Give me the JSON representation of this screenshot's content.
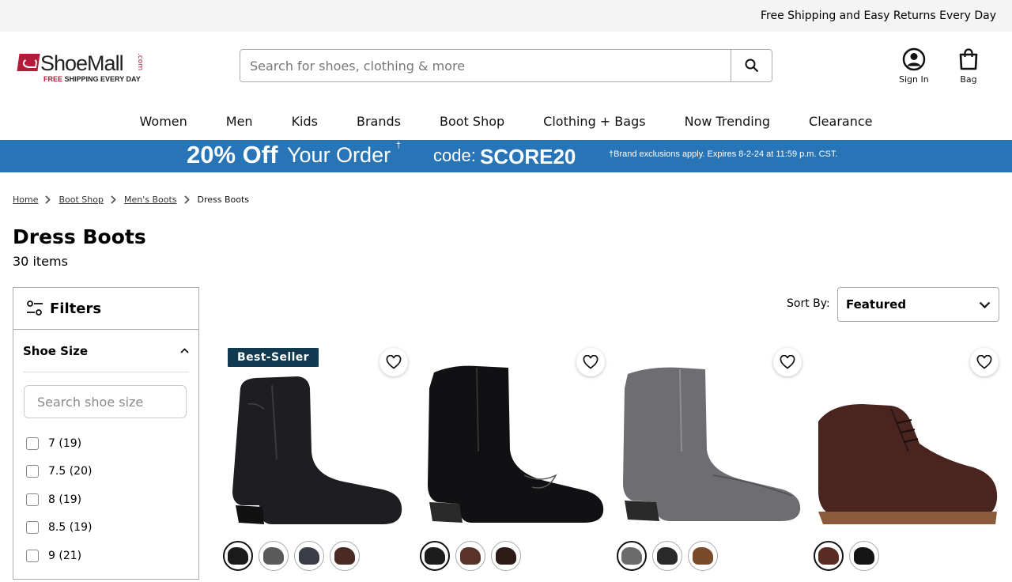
{
  "topbar": {
    "message": "Free Shipping and Easy Returns Every Day"
  },
  "logo": {
    "text": "ShoeMall",
    "dotcom": ".com",
    "tag_red": "FREE",
    "tag_rest": " SHIPPING EVERY DAY"
  },
  "search": {
    "placeholder": "Search for shoes, clothing & more"
  },
  "account": {
    "sign_in": "Sign In",
    "bag": "Bag"
  },
  "nav": {
    "women": "Women",
    "men": "Men",
    "kids": "Kids",
    "brands": "Brands",
    "boot_shop": "Boot Shop",
    "clothing": "Clothing + Bags",
    "trending": "Now Trending",
    "clearance": "Clearance"
  },
  "promo": {
    "headline_bold": "20% Off",
    "headline_rest": "Your Order",
    "dagger": "†",
    "code_label": "code:",
    "code": "SCORE20",
    "disclaimer": "†Brand exclusions apply. Expires 8-2-24 at 11:59 p.m. CST."
  },
  "breadcrumb": {
    "home": "Home",
    "boot_shop": "Boot Shop",
    "mens_boots": "Men's Boots",
    "current": "Dress Boots"
  },
  "page": {
    "title": "Dress Boots",
    "count": "30 items"
  },
  "filters": {
    "title": "Filters",
    "shoe_size": {
      "label": "Shoe Size",
      "placeholder": "Search shoe size"
    },
    "sizes": [
      "7 (19)",
      "7.5 (20)",
      "8 (19)",
      "8.5 (19)",
      "9 (21)"
    ]
  },
  "sort": {
    "label": "Sort By:",
    "selected": "Featured"
  },
  "products": [
    {
      "badge": "Best-Seller",
      "image": "black-side-zip-dress-boot",
      "swatch_colors": [
        "#1a1a1a",
        "#5a5a5a",
        "#3b3d46",
        "#4a2a22"
      ]
    },
    {
      "badge": "",
      "image": "black-western-dress-boot",
      "swatch_colors": [
        "#1c1c1c",
        "#5a3328",
        "#2e1a16"
      ]
    },
    {
      "badge": "",
      "image": "grey-side-zip-dress-boot",
      "swatch_colors": [
        "#6b6b6b",
        "#2a2a2a",
        "#7a4a2a"
      ]
    },
    {
      "badge": "",
      "image": "brown-chukka-boot",
      "swatch_colors": [
        "#5a2b22",
        "#151515"
      ]
    }
  ],
  "colors": {
    "promo": "#2774b6",
    "badge": "#0f3a4f",
    "brand_red": "#b01c3a"
  }
}
